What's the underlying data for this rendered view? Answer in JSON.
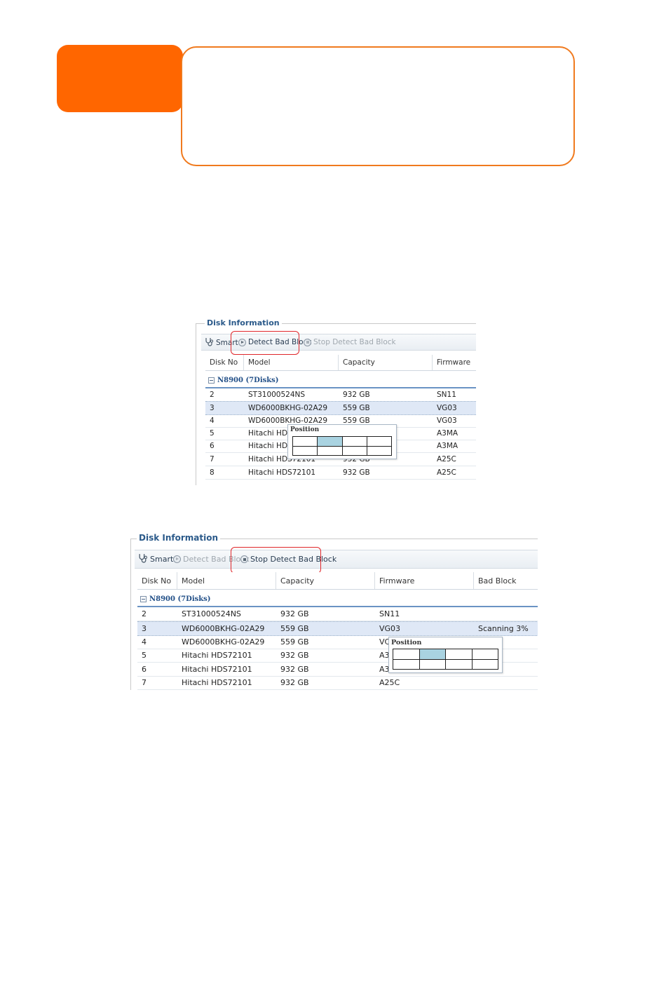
{
  "header": {
    "tab_color": "#ff6600",
    "box_border_color": "#f07a1e"
  },
  "panel1": {
    "legend": "Disk Information",
    "toolbar": {
      "smart": "Smart",
      "detect": "Detect Bad Block",
      "stop": "Stop Detect Bad Block"
    },
    "columns": [
      "Disk No",
      "Model",
      "Capacity",
      "Firmware"
    ],
    "group": "N8900 (7Disks)",
    "rows": [
      [
        "2",
        "ST31000524NS",
        "932 GB",
        "SN11"
      ],
      [
        "3",
        "WD6000BKHG-02A29",
        "559 GB",
        "VG03"
      ],
      [
        "4",
        "WD6000BKHG-02A29",
        "559 GB",
        "VG03"
      ],
      [
        "5",
        "Hitachi HDS",
        "",
        "A3MA"
      ],
      [
        "6",
        "Hitachi HDS",
        "",
        "A3MA"
      ],
      [
        "7",
        "Hitachi HDS72101",
        "932 GB",
        "A25C"
      ],
      [
        "8",
        "Hitachi HDS72101",
        "932 GB",
        "A25C"
      ]
    ],
    "popup_title": "Position"
  },
  "panel2": {
    "legend": "Disk Information",
    "toolbar": {
      "smart": "Smart",
      "detect": "Detect Bad Block",
      "stop": "Stop Detect Bad Block"
    },
    "columns": [
      "Disk No",
      "Model",
      "Capacity",
      "Firmware",
      "Bad Block"
    ],
    "group": "N8900 (7Disks)",
    "rows": [
      [
        "2",
        "ST31000524NS",
        "932 GB",
        "SN11",
        ""
      ],
      [
        "3",
        "WD6000BKHG-02A29",
        "559 GB",
        "VG03",
        "Scanning 3%"
      ],
      [
        "4",
        "WD6000BKHG-02A29",
        "559 GB",
        "VC",
        ""
      ],
      [
        "5",
        "Hitachi HDS72101",
        "932 GB",
        "A3",
        ""
      ],
      [
        "6",
        "Hitachi HDS72101",
        "932 GB",
        "A3",
        ""
      ],
      [
        "7",
        "Hitachi HDS72101",
        "932 GB",
        "A25C",
        ""
      ]
    ],
    "popup_title": "Position"
  }
}
